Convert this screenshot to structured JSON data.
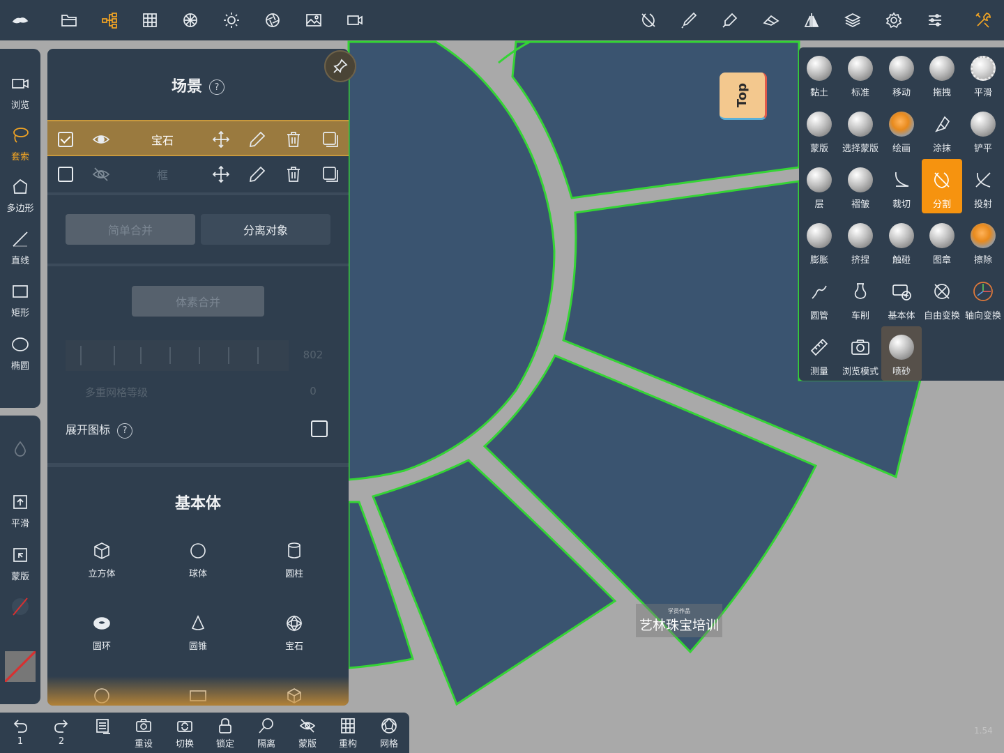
{
  "scene_panel": {
    "title": "场景",
    "help": "?",
    "objects": [
      {
        "name": "宝石",
        "visible": true,
        "selected": true
      },
      {
        "name": "框",
        "visible": false,
        "selected": false
      }
    ],
    "simple_merge": "简单合并",
    "separate": "分离对象",
    "volume_merge": "体素合并",
    "grid_value": "802",
    "multires_label": "多重网格等级",
    "multires_value": "0",
    "expand_icons": "展开图标",
    "primitives_title": "基本体",
    "primitives": [
      {
        "label": "立方体",
        "icon": "cube-icon"
      },
      {
        "label": "球体",
        "icon": "sphere-icon"
      },
      {
        "label": "圆柱",
        "icon": "cylinder-icon"
      },
      {
        "label": "圆环",
        "icon": "torus-icon"
      },
      {
        "label": "圆锥",
        "icon": "cone-icon"
      },
      {
        "label": "宝石",
        "icon": "gem-icon"
      }
    ]
  },
  "left_tools": [
    {
      "label": "浏览",
      "icon": "camera-icon"
    },
    {
      "label": "套索",
      "icon": "lasso-icon"
    },
    {
      "label": "多边形",
      "icon": "polygon-icon"
    },
    {
      "label": "直线",
      "icon": "line-icon"
    },
    {
      "label": "矩形",
      "icon": "rectangle-icon"
    },
    {
      "label": "椭圆",
      "icon": "ellipse-icon"
    }
  ],
  "left_tools2": [
    {
      "label": "平滑",
      "icon": "smooth-icon"
    },
    {
      "label": "蒙版",
      "icon": "mask-icon"
    }
  ],
  "bottom_bar": [
    {
      "label": "1",
      "icon": "undo-icon"
    },
    {
      "label": "2",
      "icon": "redo-icon"
    },
    {
      "label": "",
      "icon": "layers-stack-icon"
    },
    {
      "label": "重设",
      "icon": "reset-camera-icon"
    },
    {
      "label": "切换",
      "icon": "switch-icon"
    },
    {
      "label": "锁定",
      "icon": "lock-icon"
    },
    {
      "label": "隔离",
      "icon": "isolate-icon"
    },
    {
      "label": "蒙版",
      "icon": "mask-eye-icon"
    },
    {
      "label": "重构",
      "icon": "remesh-icon"
    },
    {
      "label": "网格",
      "icon": "mesh-icon"
    }
  ],
  "brushes": [
    {
      "label": "黏土",
      "type": "ball"
    },
    {
      "label": "标准",
      "type": "ball"
    },
    {
      "label": "移动",
      "type": "ball"
    },
    {
      "label": "拖拽",
      "type": "ball"
    },
    {
      "label": "平滑",
      "type": "stone"
    },
    {
      "label": "蒙版",
      "type": "ball"
    },
    {
      "label": "选择蒙版",
      "type": "ball"
    },
    {
      "label": "绘画",
      "type": "org"
    },
    {
      "label": "涂抹",
      "type": "icon"
    },
    {
      "label": "铲平",
      "type": "ball"
    },
    {
      "label": "层",
      "type": "ball"
    },
    {
      "label": "褶皱",
      "type": "ball"
    },
    {
      "label": "裁切",
      "type": "icon"
    },
    {
      "label": "分割",
      "type": "icon",
      "active": true
    },
    {
      "label": "投射",
      "type": "icon"
    },
    {
      "label": "膨胀",
      "type": "ball"
    },
    {
      "label": "挤捏",
      "type": "ball"
    },
    {
      "label": "触碰",
      "type": "ball"
    },
    {
      "label": "图章",
      "type": "ball"
    },
    {
      "label": "擦除",
      "type": "org"
    },
    {
      "label": "圆管",
      "type": "icon"
    },
    {
      "label": "车削",
      "type": "icon"
    },
    {
      "label": "基本体",
      "type": "icon"
    },
    {
      "label": "自由变换",
      "type": "icon"
    },
    {
      "label": "轴向变换",
      "type": "icon"
    },
    {
      "label": "测量",
      "type": "icon"
    },
    {
      "label": "浏览模式",
      "type": "icon"
    },
    {
      "label": "喷砂",
      "type": "ball",
      "active2": true
    }
  ],
  "view_cube": "Top",
  "watermark": {
    "small": "学员作品",
    "big": "艺林珠宝培训"
  },
  "version": "1.54",
  "colors": {
    "panel": "#2f3e4e",
    "accent": "#f6930f",
    "selection": "#9a7a3f",
    "mesh": "#3a5470",
    "outline": "#35d435"
  }
}
